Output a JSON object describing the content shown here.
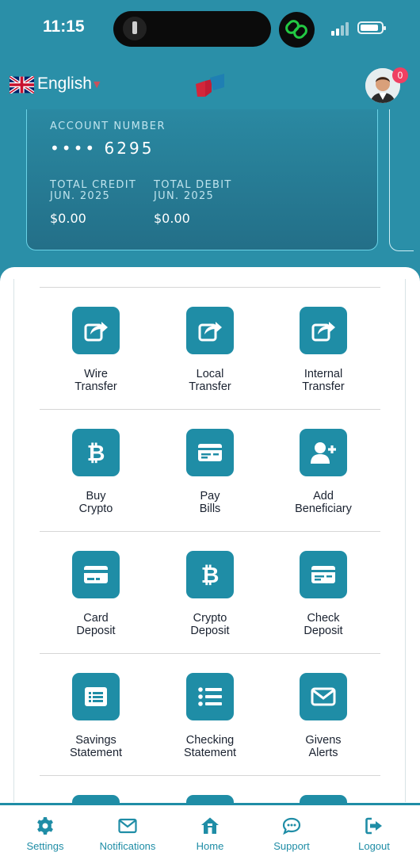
{
  "status": {
    "time": "11:15"
  },
  "header": {
    "language": "English",
    "notification_count": "0"
  },
  "card": {
    "account_label": "ACCOUNT NUMBER",
    "account_number": "•••• 6295",
    "credit_label": "TOTAL CREDIT",
    "credit_period": "JUN. 2025",
    "credit_value": "$0.00",
    "debit_label": "TOTAL DEBIT",
    "debit_period": "JUN. 2025",
    "debit_value": "$0.00"
  },
  "actions": [
    {
      "line1": "Wire",
      "line2": "Transfer",
      "icon": "share-icon"
    },
    {
      "line1": "Local",
      "line2": "Transfer",
      "icon": "share-icon"
    },
    {
      "line1": "Internal",
      "line2": "Transfer",
      "icon": "share-icon"
    },
    {
      "line1": "Buy",
      "line2": "Crypto",
      "icon": "bitcoin-icon"
    },
    {
      "line1": "Pay",
      "line2": "Bills",
      "icon": "bill-card-icon"
    },
    {
      "line1": "Add",
      "line2": "Beneficiary",
      "icon": "add-user-icon"
    },
    {
      "line1": "Card",
      "line2": "Deposit",
      "icon": "credit-card-icon"
    },
    {
      "line1": "Crypto",
      "line2": "Deposit",
      "icon": "bitcoin-icon"
    },
    {
      "line1": "Check",
      "line2": "Deposit",
      "icon": "bill-card-icon"
    },
    {
      "line1": "Savings",
      "line2": "Statement",
      "icon": "list-box-icon"
    },
    {
      "line1": "Checking",
      "line2": "Statement",
      "icon": "list-icon"
    },
    {
      "line1": "Givens",
      "line2": "Alerts",
      "icon": "envelope-icon"
    }
  ],
  "nav": [
    {
      "label": "Settings",
      "icon": "gear-icon"
    },
    {
      "label": "Notifications",
      "icon": "envelope-icon"
    },
    {
      "label": "Home",
      "icon": "home-icon"
    },
    {
      "label": "Support",
      "icon": "chat-icon"
    },
    {
      "label": "Logout",
      "icon": "logout-icon"
    }
  ],
  "colors": {
    "brand": "#1f8da6",
    "header_bg": "#2a8fa8",
    "badge": "#ef3f62"
  }
}
